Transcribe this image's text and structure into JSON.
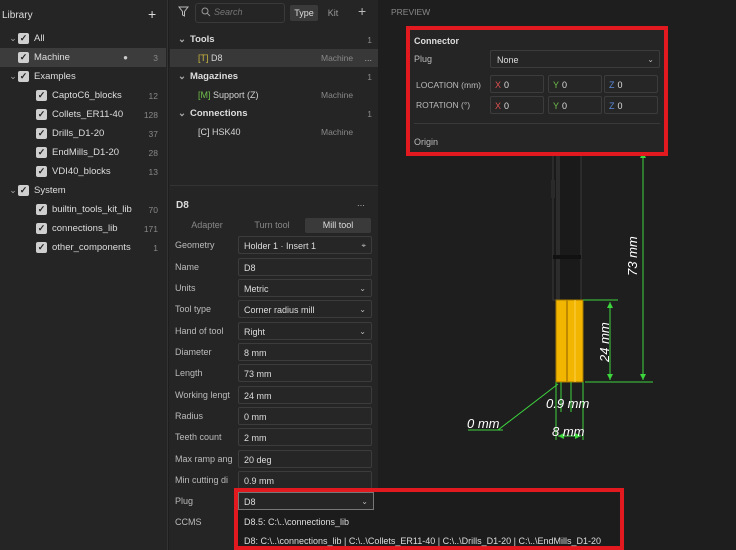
{
  "library": {
    "title": "Library",
    "tree": [
      {
        "label": "All",
        "count": ""
      },
      {
        "label": "Machine",
        "count": "3",
        "dot": "●"
      },
      {
        "label": "Examples",
        "count": ""
      },
      {
        "label": "CaptoC6_blocks",
        "count": "12"
      },
      {
        "label": "Collets_ER11-40",
        "count": "128"
      },
      {
        "label": "Drills_D1-20",
        "count": "37"
      },
      {
        "label": "EndMills_D1-20",
        "count": "28"
      },
      {
        "label": "VDI40_blocks",
        "count": "13"
      },
      {
        "label": "System",
        "count": ""
      },
      {
        "label": "builtin_tools_kit_lib",
        "count": "70"
      },
      {
        "label": "connections_lib",
        "count": "171"
      },
      {
        "label": "other_components",
        "count": "1"
      }
    ]
  },
  "toolbar": {
    "search_placeholder": "Search",
    "type_label": "Type",
    "kit_label": "Kit"
  },
  "tools_list": {
    "groups": [
      {
        "title": "Tools",
        "count": "1",
        "items": [
          {
            "tag": "[T]",
            "name": "D8",
            "location": "Machine",
            "more": "..."
          }
        ]
      },
      {
        "title": "Magazines",
        "count": "1",
        "items": [
          {
            "tag": "[M]",
            "name": "Support (Z)",
            "location": "Machine"
          }
        ]
      },
      {
        "title": "Connections",
        "count": "1",
        "items": [
          {
            "tag": "[C]",
            "name": "HSK40",
            "location": "Machine"
          }
        ]
      }
    ]
  },
  "properties": {
    "title": "D8",
    "more": "...",
    "tabs": [
      "Adapter",
      "Turn tool",
      "Mill tool"
    ],
    "rows": [
      {
        "label": "Geometry",
        "value": "Holder 1 · Insert 1"
      },
      {
        "label": "Name",
        "value": "D8"
      },
      {
        "label": "Units",
        "value": "Metric"
      },
      {
        "label": "Tool type",
        "value": "Corner radius mill"
      },
      {
        "label": "Hand of tool",
        "value": "Right"
      },
      {
        "label": "Diameter",
        "value": "8 mm"
      },
      {
        "label": "Length",
        "value": "73 mm"
      },
      {
        "label": "Working lengt",
        "value": "24 mm"
      },
      {
        "label": "Radius",
        "value": "0 mm"
      },
      {
        "label": "Teeth count",
        "value": "2 mm"
      },
      {
        "label": "Max ramp ang",
        "value": "20 deg"
      },
      {
        "label": "Min cutting di",
        "value": "0.9 mm"
      },
      {
        "label": "Plug",
        "value": "D8"
      },
      {
        "label": "CCMS",
        "value": ""
      }
    ]
  },
  "preview": {
    "label": "PREVIEW",
    "dimensions": {
      "length": "73 mm",
      "working": "24 mm",
      "min_cut": "0.9 mm",
      "radius": "0 mm",
      "diameter": "8 mm"
    }
  },
  "connector": {
    "title": "Connector",
    "plug_label": "Plug",
    "plug_value": "None",
    "location_label": "LOCATION (mm)",
    "rotation_label": "ROTATION (°)",
    "location": {
      "x": "0",
      "y": "0",
      "z": "0"
    },
    "rotation": {
      "x": "0",
      "y": "0",
      "z": "0"
    },
    "axis_labels": {
      "x": "X",
      "y": "Y",
      "z": "Z"
    },
    "origin_label": "Origin"
  },
  "autocomplete": {
    "input_value": "D8",
    "items": [
      "D8.5: C:\\..\\connections_lib",
      "D8: C:\\..\\connections_lib | C:\\..\\Collets_ER11-40 | C:\\..\\Drills_D1-20 | C:\\..\\EndMills_D1-20"
    ]
  },
  "colors": {
    "highlight_border": "#e2191f",
    "tool_yellow": "#f2b500",
    "dimension_green": "#3dd43d"
  }
}
